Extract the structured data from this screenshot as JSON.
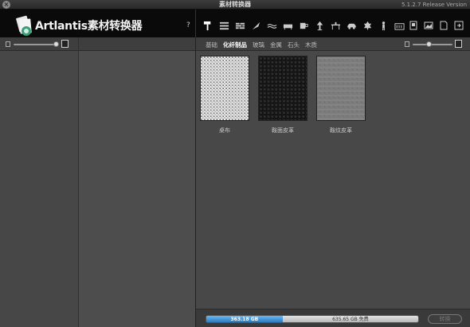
{
  "window": {
    "title": "素材转换器",
    "version": "5.1.2.7 Release Version"
  },
  "header": {
    "app_name": "Artlantis素材转换器",
    "help": "?"
  },
  "categories": [
    {
      "icon": "paint-roller-icon"
    },
    {
      "icon": "wall-icon"
    },
    {
      "icon": "brick-icon"
    },
    {
      "icon": "trowel-icon"
    },
    {
      "icon": "water-icon"
    },
    {
      "icon": "sofa-icon"
    },
    {
      "icon": "cup-icon"
    },
    {
      "icon": "lamp-icon"
    },
    {
      "icon": "table-icon"
    },
    {
      "icon": "car-icon"
    },
    {
      "icon": "leaf-icon"
    },
    {
      "icon": "person-icon"
    },
    {
      "icon": "building-icon"
    }
  ],
  "views": [
    {
      "icon": "single-view-icon"
    },
    {
      "icon": "image-view-icon"
    },
    {
      "icon": "page-view-icon"
    },
    {
      "icon": "export-icon"
    }
  ],
  "tabs": [
    {
      "label": "基础",
      "active": false
    },
    {
      "label": "化纤制品",
      "active": true
    },
    {
      "label": "玻璃",
      "active": false
    },
    {
      "label": "金属",
      "active": false
    },
    {
      "label": "石头",
      "active": false
    },
    {
      "label": "木质",
      "active": false
    }
  ],
  "materials": [
    {
      "caption": "桌布",
      "texture": "woven-fabric"
    },
    {
      "caption": "鞍面皮革",
      "texture": "black-leather"
    },
    {
      "caption": "鞍纹皮革",
      "texture": "grey-leather"
    }
  ],
  "footer": {
    "used_label": "363.18 GB",
    "free_label": "635.65 GB 免费",
    "used_fraction": 0.36,
    "convert_label": "转换"
  },
  "colors": {
    "disk_used": "#2a7cc4",
    "header_bg": "#0a0a0a"
  }
}
